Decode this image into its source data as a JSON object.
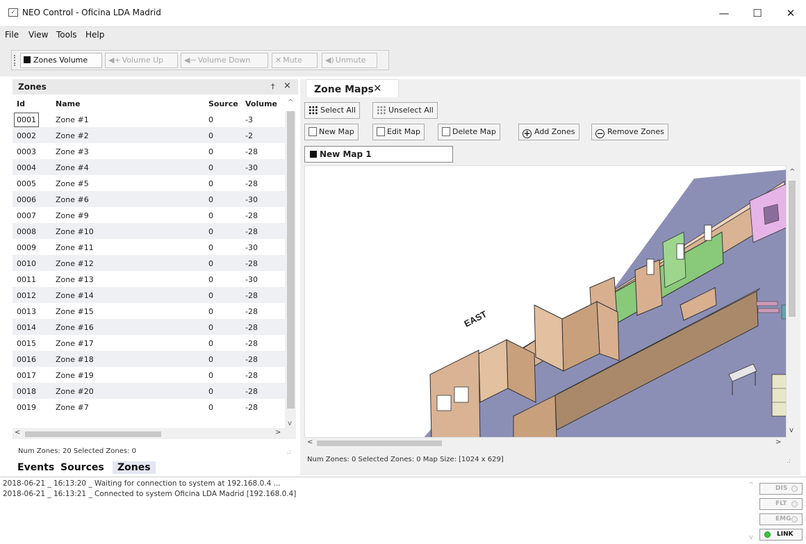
{
  "window": {
    "title": "NEO Control - Oficina LDA Madrid",
    "icon": "app-icon",
    "controls": [
      "minimize",
      "maximize",
      "close"
    ]
  },
  "menu": [
    "File",
    "View",
    "Tools",
    "Help"
  ],
  "toolbar": {
    "zones_volume": "Zones Volume",
    "volume_up": "Volume Up",
    "volume_down": "Volume Down",
    "mute": "Mute",
    "unmute": "Unmute"
  },
  "zones_panel": {
    "title": "Zones",
    "columns": [
      "Id",
      "Name",
      "Source",
      "Volume"
    ],
    "rows": [
      {
        "id": "0001",
        "name": "Zone #1",
        "source": "0",
        "volume": "-3"
      },
      {
        "id": "0002",
        "name": "Zone #2",
        "source": "0",
        "volume": "-2"
      },
      {
        "id": "0003",
        "name": "Zone #3",
        "source": "0",
        "volume": "-28"
      },
      {
        "id": "0004",
        "name": "Zone #4",
        "source": "0",
        "volume": "-30"
      },
      {
        "id": "0005",
        "name": "Zone #5",
        "source": "0",
        "volume": "-28"
      },
      {
        "id": "0006",
        "name": "Zone #6",
        "source": "0",
        "volume": "-30"
      },
      {
        "id": "0007",
        "name": "Zone #9",
        "source": "0",
        "volume": "-28"
      },
      {
        "id": "0008",
        "name": "Zone #10",
        "source": "0",
        "volume": "-28"
      },
      {
        "id": "0009",
        "name": "Zone #11",
        "source": "0",
        "volume": "-30"
      },
      {
        "id": "0010",
        "name": "Zone #12",
        "source": "0",
        "volume": "-28"
      },
      {
        "id": "0011",
        "name": "Zone #13",
        "source": "0",
        "volume": "-30"
      },
      {
        "id": "0012",
        "name": "Zone #14",
        "source": "0",
        "volume": "-28"
      },
      {
        "id": "0013",
        "name": "Zone #15",
        "source": "0",
        "volume": "-28"
      },
      {
        "id": "0014",
        "name": "Zone #16",
        "source": "0",
        "volume": "-28"
      },
      {
        "id": "0015",
        "name": "Zone #17",
        "source": "0",
        "volume": "-28"
      },
      {
        "id": "0016",
        "name": "Zone #18",
        "source": "0",
        "volume": "-28"
      },
      {
        "id": "0017",
        "name": "Zone #19",
        "source": "0",
        "volume": "-28"
      },
      {
        "id": "0018",
        "name": "Zone #20",
        "source": "0",
        "volume": "-28"
      },
      {
        "id": "0019",
        "name": "Zone #7",
        "source": "0",
        "volume": "-28"
      }
    ],
    "status": "Num Zones: 20   Selected Zones: 0"
  },
  "bottom_tabs": [
    "Events",
    "Sources",
    "Zones"
  ],
  "maps_panel": {
    "tab_title": "Zone Maps",
    "select_all": "Select All",
    "unselect_all": "Unselect All",
    "new_map": "New Map",
    "edit_map": "Edit Map",
    "delete_map": "Delete Map",
    "add_zones": "Add Zones",
    "remove_zones": "Remove Zones",
    "map_name": "New Map 1",
    "map_label": "EAST",
    "status": "Num Zones: 0    Selected Zones: 0    Map Size: [1024 x 629]"
  },
  "log": [
    "2018-06-21 _ 16:13:20 _ Waiting for connection to system at 192.168.0.4 ...",
    "2018-06-21 _ 16:13:21 _ Connected to system Oficina LDA Madrid [192.168.0.4]"
  ],
  "indicators": [
    {
      "label": "DIS",
      "on": false
    },
    {
      "label": "FLT",
      "on": false
    },
    {
      "label": "EMG",
      "on": false
    },
    {
      "label": "LINK",
      "on": true
    }
  ]
}
